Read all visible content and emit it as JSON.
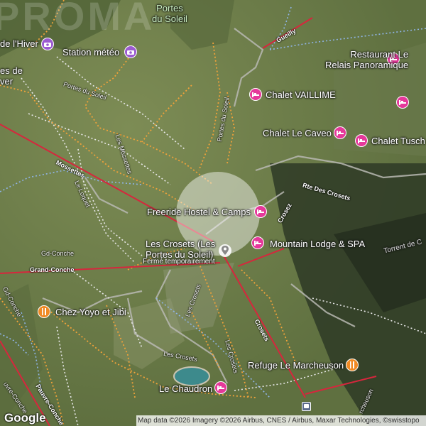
{
  "colors": {
    "lodging": "#e5389a",
    "food": "#f08a24",
    "weather": "#9c5bd0",
    "transit": "#5b6b8c",
    "lift_line": "#d7263d",
    "piste_orange": "#f0a23a",
    "trail_white": "#e8e8e8",
    "path_blue": "#8fb4e6"
  },
  "watermark": "PROMA",
  "labels": {
    "portes_du_soleil_top": "Portes\ndu Soleil",
    "de_l_hiver": "de l'Hiver",
    "station_meteo": "Station météo",
    "es_de_hiver": "es de\nver",
    "restaurant": "Restaurant Le\nRelais Panoramique",
    "chalet_vaillime": "Chalet VAILLIME",
    "chalet_le_caveo": "Chalet Le Caveo",
    "chalet_tusch": "Chalet Tusch",
    "freeride": "Freeride Hostel & Camps",
    "les_crosets": "Les Crosets (Les\nPortes du Soleil)",
    "ferme": "Fermé temporairement",
    "mountain_lodge": "Mountain Lodge & SPA",
    "chez_yoyo": "Chez Yoyo et Jibi",
    "refuge": "Refuge Le Marcheuson",
    "le_chaudron": "Le Chaudron",
    "torrent": "Torrent de C"
  },
  "roads": {
    "gueilly": "Gueilly",
    "portes_du_soleil_a": "Portes du Soleil",
    "portes_du_soleil_b": "Portes du Soleil",
    "les_mossettes": "Les Mossettes",
    "mossettes": "Mossettes",
    "le_loquet": "Le Loquet",
    "rte_des_crosets": "Rte Des Crosets",
    "crosez": "Crosez",
    "gd_conche": "Gd-Conche",
    "grand_conche": "Grand-Conche",
    "gd_conche_vert": "Gd-Conche",
    "les_crosets_road": "Les Crosets",
    "les_crosets_road2": "Les Crosets",
    "crosets": "Crosets",
    "pauvre_conche": "Pauvre-Conche",
    "ouvre_conche": "uvre-Conche",
    "marcheuson": "rcheuson"
  },
  "attribution": "Map data ©2026 Imagery ©2026 Airbus, CNES / Airbus, Maxar Technologies, ©swisstopo",
  "logo": "Google"
}
